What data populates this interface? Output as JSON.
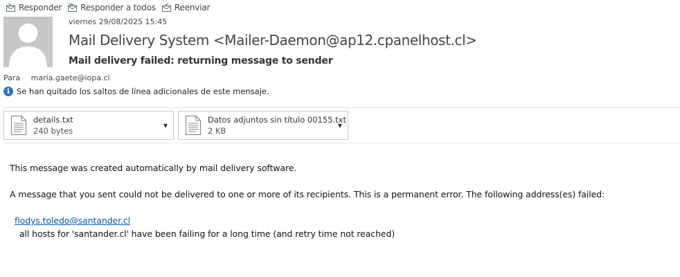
{
  "toolbar": {
    "reply_label": "Responder",
    "reply_all_label": "Responder a todos",
    "forward_label": "Reenviar"
  },
  "header": {
    "date": "viernes 29/08/2025 15:45",
    "sender": "Mail Delivery System <Mailer-Daemon@ap12.cpanelhost.cl>",
    "subject": "Mail delivery failed: returning message to sender",
    "to_label": "Para",
    "to_value": "maria.gaete@iopa.cl",
    "info_notice": "Se han quitado los saltos de línea adicionales de este mensaje."
  },
  "attachments": [
    {
      "name": "details.txt",
      "size": "240 bytes"
    },
    {
      "name": "Datos adjuntos sin título 00155.txt",
      "size": "2 KB"
    }
  ],
  "body": {
    "line1": "This message was created automatically by mail delivery software.",
    "line2": "A message that you sent could not be delivered to one or more of its recipients. This is a permanent error. The following address(es) failed:",
    "failed_address": "flodys.toledo@santander.cl",
    "failure_reason": "all hosts for 'santander.cl' have been failing for a long time (and retry time not reached)"
  },
  "colors": {
    "link": "#0b57a4",
    "info_icon": "#2e75b6",
    "avatar_bg": "#c6c6c6"
  }
}
